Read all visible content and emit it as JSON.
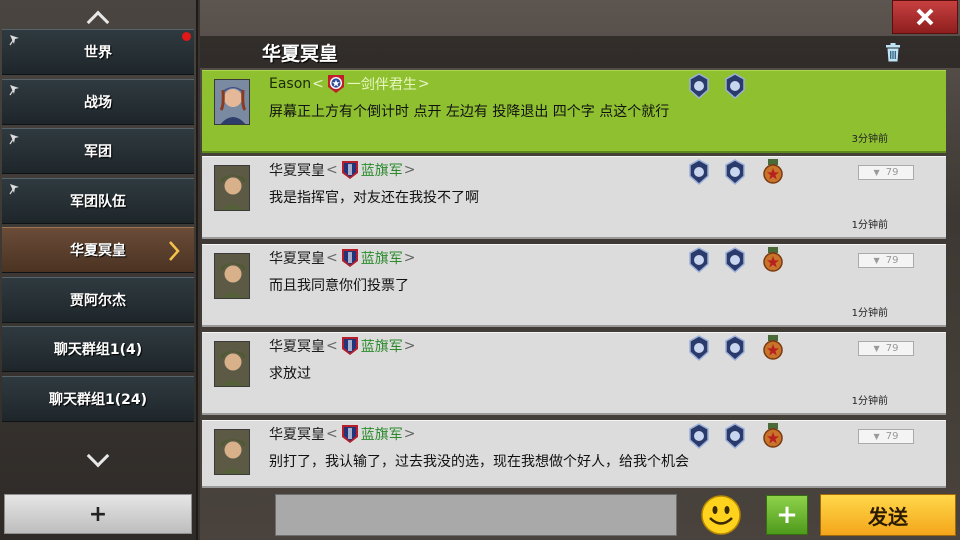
{
  "sidebar": {
    "items": [
      {
        "label": "世界",
        "pinned": true,
        "unread": true
      },
      {
        "label": "战场",
        "pinned": true
      },
      {
        "label": "军团",
        "pinned": true
      },
      {
        "label": "军团队伍",
        "pinned": true
      },
      {
        "label": "华夏冥皇",
        "active": true
      },
      {
        "label": "贾阿尔杰"
      },
      {
        "label": "聊天群组1(4)"
      },
      {
        "label": "聊天群组1(24)"
      }
    ],
    "add_label": "+"
  },
  "header": {
    "title": "华夏冥皇"
  },
  "messages": [
    {
      "sender": "Eason",
      "legion": "一剑伴君生",
      "text": "屏幕正上方有个倒计时 点开  左边有 投降退出 四个字  点这个就行",
      "time": "3分钟前",
      "highlight": true
    },
    {
      "sender": "华夏冥皇",
      "legion": "蓝旗军",
      "text": "我是指挥官，对友还在我投不了啊",
      "time": "1分钟前",
      "report": "79"
    },
    {
      "sender": "华夏冥皇",
      "legion": "蓝旗军",
      "text": "而且我同意你们投票了",
      "time": "1分钟前",
      "report": "79"
    },
    {
      "sender": "华夏冥皇",
      "legion": "蓝旗军",
      "text": "求放过",
      "time": "1分钟前",
      "report": "79"
    },
    {
      "sender": "华夏冥皇",
      "legion": "蓝旗军",
      "text": "别打了，我认输了，过去我没的选，现在我想做个好人，给我个机会",
      "time": "",
      "report": "79"
    }
  ],
  "input": {
    "value": "",
    "placeholder": ""
  },
  "buttons": {
    "send_label": "发送",
    "plus_label": "+",
    "close_label": "×"
  },
  "lt": "<",
  "gt": ">",
  "colors": {
    "highlight": "#8ec030",
    "message_bg": "#dcdcdc",
    "legion_text": "#2a8a2a",
    "send_button": "#f4b41a",
    "close_button": "#b83030",
    "active_tab": "#5e4230"
  },
  "icons": {
    "up": "chevron-up-icon",
    "down": "chevron-down-icon",
    "pin": "pin-icon",
    "trash": "trash-icon",
    "close": "close-icon",
    "emoji": "smiley-icon",
    "medal_rank": "rank-badge-icon",
    "medal_star": "star-medal-icon"
  }
}
